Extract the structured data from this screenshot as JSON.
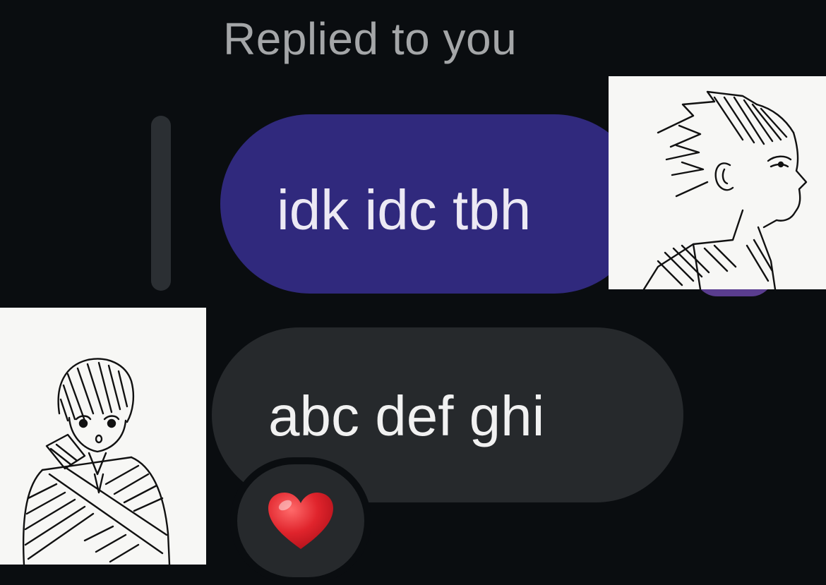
{
  "reply_header": {
    "label": "Replied to you"
  },
  "messages": [
    {
      "sender": "you",
      "text": "idk idc tbh",
      "bubble_color": "#30297d"
    },
    {
      "sender": "other",
      "text": "abc def ghi",
      "bubble_color": "#26292c",
      "reaction": "heart"
    }
  ],
  "colors": {
    "background": "#0a0d10",
    "reply_bar": "#2b2f33",
    "sent_bubble": "#30297d",
    "received_bubble": "#26292c",
    "heart": "#e0242c"
  },
  "stickers": [
    {
      "depicts": "sketch of character in profile view"
    },
    {
      "depicts": "sketch of character with bandage strap"
    }
  ]
}
